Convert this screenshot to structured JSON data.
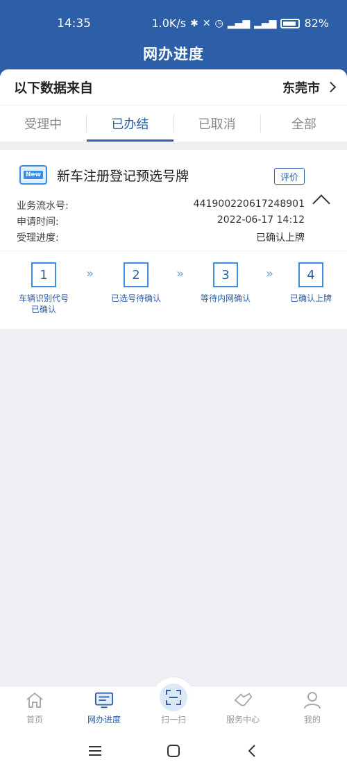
{
  "status_bar": {
    "time": "14:35",
    "net_speed": "1.0K/s",
    "battery": "82%"
  },
  "header": {
    "title": "网办进度"
  },
  "data_source": {
    "label": "以下数据来自",
    "city": "东莞市"
  },
  "tabs": [
    {
      "label": "受理中",
      "active": false
    },
    {
      "label": "已办结",
      "active": true
    },
    {
      "label": "已取消",
      "active": false
    },
    {
      "label": "全部",
      "active": false
    }
  ],
  "card": {
    "badge": "New",
    "title": "新车注册登记预选号牌",
    "rate_label": "评价",
    "fields": [
      {
        "label": "业务流水号:",
        "value": "441900220617248901"
      },
      {
        "label": "申请时间:",
        "value": "2022-06-17 14:12"
      },
      {
        "label": "受理进度:",
        "value": "已确认上牌"
      }
    ],
    "steps": [
      {
        "num": "1",
        "line1": "车辆识别代号",
        "line2": "已确认"
      },
      {
        "num": "2",
        "line1": "已选号待确认",
        "line2": ""
      },
      {
        "num": "3",
        "line1": "等待内网确认",
        "line2": ""
      },
      {
        "num": "4",
        "line1": "已确认上牌",
        "line2": ""
      }
    ],
    "arrow": "»"
  },
  "bottom_nav": [
    {
      "label": "首页",
      "icon": "home-icon",
      "active": false
    },
    {
      "label": "网办进度",
      "icon": "progress-icon",
      "active": true
    },
    {
      "label": "扫一扫",
      "icon": "scan-icon",
      "active": false
    },
    {
      "label": "服务中心",
      "icon": "service-icon",
      "active": false
    },
    {
      "label": "我的",
      "icon": "user-icon",
      "active": false
    }
  ],
  "colors": {
    "primary": "#2d5fa8",
    "accent": "#3a8de0",
    "background": "#eef0f4"
  }
}
